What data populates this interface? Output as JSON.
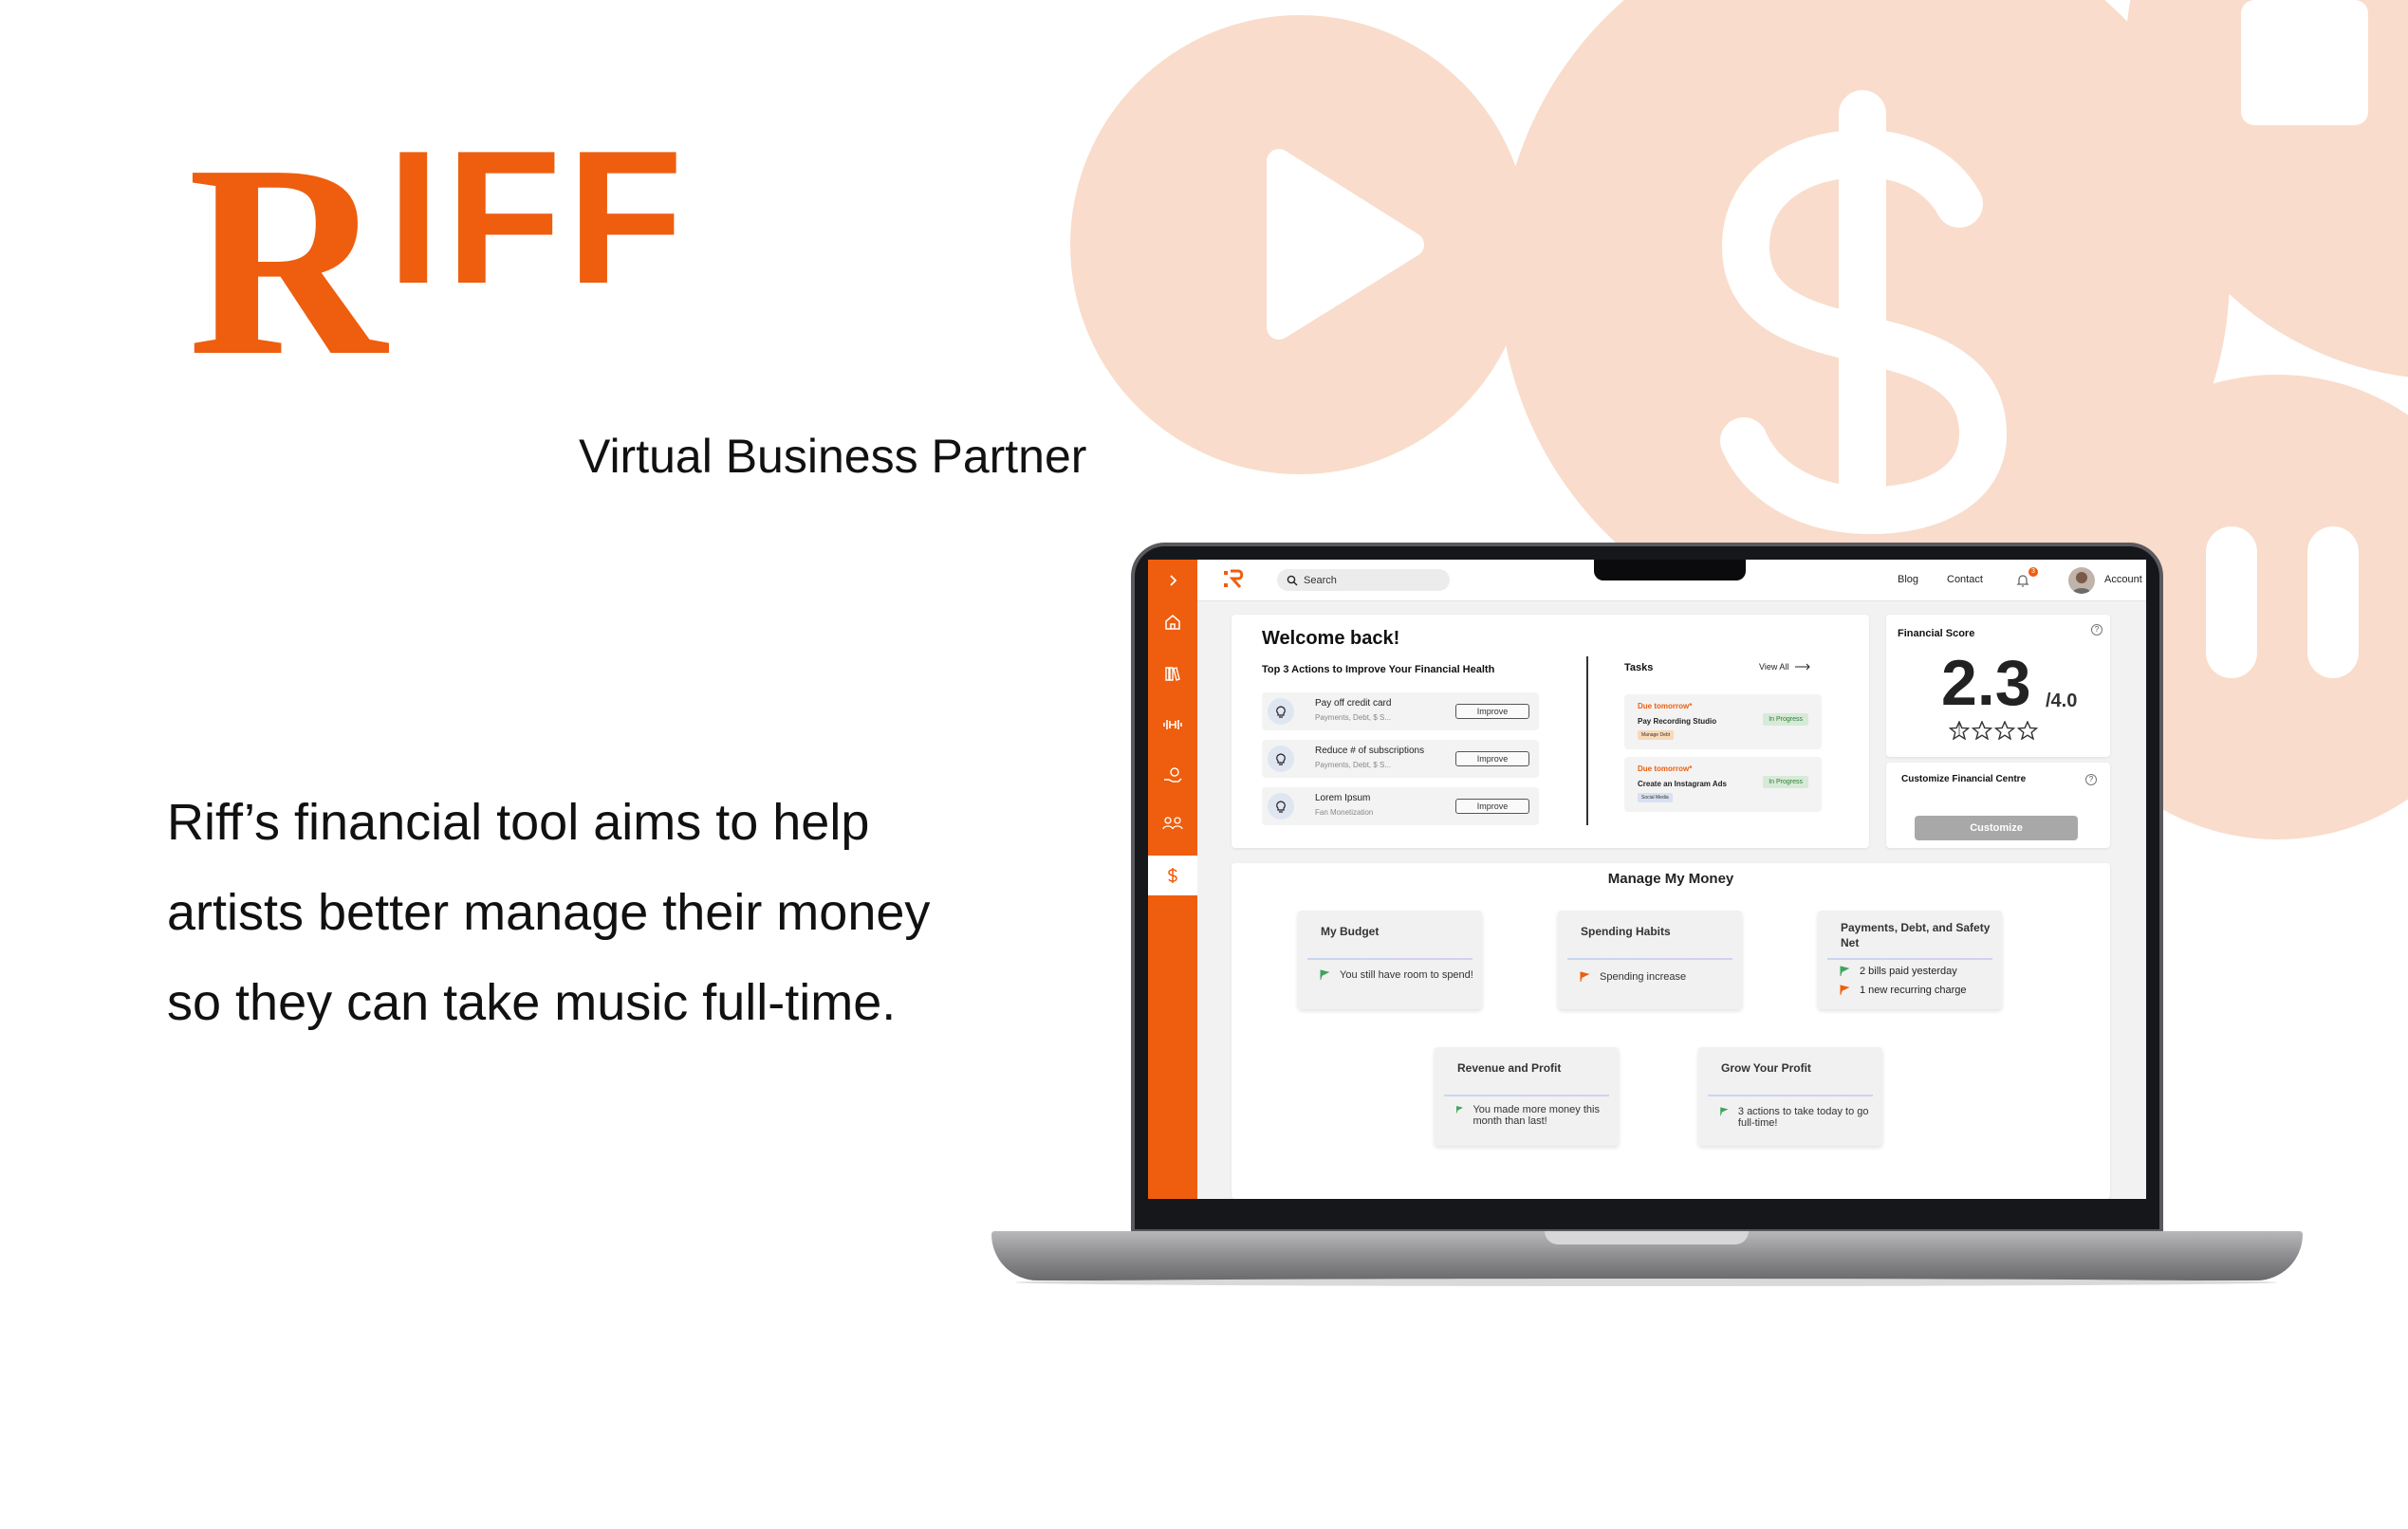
{
  "brand": {
    "logo_r": "R",
    "logo_rest": "IFF",
    "tagline": "Virtual Business Partner",
    "description": "Riff’s financial tool aims to help artists better manage their money so they can take music full-time."
  },
  "colors": {
    "accent": "#EE5E0E",
    "decor_peach": "#F9DCCB",
    "sidebar_active": "#FFFFFF"
  },
  "decor_icons": [
    "play-icon",
    "dollar-icon",
    "stop-icon",
    "pause-icon"
  ],
  "app": {
    "logo": "R",
    "search": {
      "placeholder": "Search"
    },
    "nav": {
      "blog": "Blog",
      "contact": "Contact",
      "notification_count": "3",
      "account": "Account"
    },
    "sidebar": [
      {
        "icon": "chevron-right-icon"
      },
      {
        "icon": "home-icon"
      },
      {
        "icon": "library-icon"
      },
      {
        "icon": "dumbbell-icon"
      },
      {
        "icon": "hand-coin-icon"
      },
      {
        "icon": "community-icon"
      },
      {
        "icon": "dollar-icon",
        "active": true
      }
    ],
    "welcome": {
      "title": "Welcome back!",
      "actions_heading": "Top 3 Actions to Improve Your Financial Health",
      "actions": [
        {
          "title": "Pay off credit card",
          "tags": "Payments, Debt, $ S...",
          "button": "Improve"
        },
        {
          "title": "Reduce # of subscriptions",
          "tags": "Payments, Debt, $ S...",
          "button": "Improve"
        },
        {
          "title": "Lorem Ipsum",
          "tags": "Fan Monetization",
          "button": "Improve"
        }
      ],
      "tasks_heading": "Tasks",
      "view_all": "View All",
      "tasks": [
        {
          "due": "Due tomorrow*",
          "title": "Pay Recording Studio",
          "tag": "Manage Debt",
          "status": "In Progress",
          "tag_color": "#f7d9b8"
        },
        {
          "due": "Due tomorrow*",
          "title": "Create an Instagram Ads",
          "tag": "Social Media",
          "status": "In Progress",
          "tag_color": "#d8e0f2"
        }
      ]
    },
    "financial_score": {
      "title": "Financial Score",
      "score": "2.3",
      "out_of": "/4.0",
      "stars": 4,
      "help": "?"
    },
    "customize": {
      "title": "Customize Financial Centre",
      "button": "Customize",
      "help": "?"
    },
    "manage_money": {
      "title": "Manage My Money",
      "cards": [
        {
          "title": "My Budget",
          "items": [
            {
              "flag": "green",
              "text": "You still have room to spend!"
            }
          ]
        },
        {
          "title": "Spending Habits",
          "items": [
            {
              "flag": "orange",
              "text": "Spending increase"
            }
          ]
        },
        {
          "title": "Payments, Debt, and Safety Net",
          "items": [
            {
              "flag": "green",
              "text": "2 bills paid yesterday"
            },
            {
              "flag": "orange",
              "text": "1 new recurring charge"
            }
          ]
        },
        {
          "title": "Revenue and Profit",
          "items": [
            {
              "flag": "green",
              "text": "You made more money this month than last!"
            }
          ]
        },
        {
          "title": "Grow Your Profit",
          "items": [
            {
              "flag": "green",
              "text": "3 actions to take today to go full-time!"
            }
          ]
        }
      ]
    }
  }
}
